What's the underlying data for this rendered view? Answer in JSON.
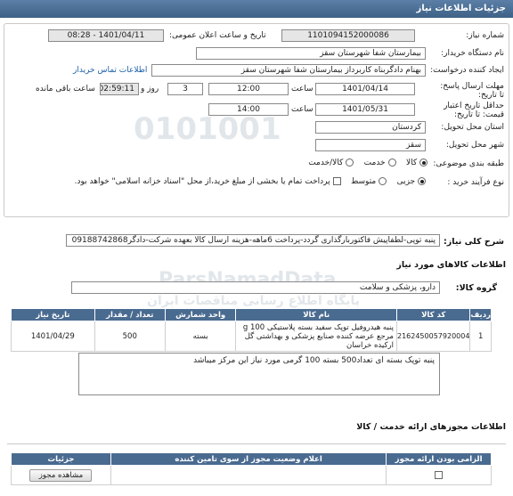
{
  "header": {
    "title": "جزئیات اطلاعات نیاز"
  },
  "fields": {
    "need_number_label": "شماره نیاز:",
    "need_number": "1101094152000086",
    "announce_label": "تاریخ و ساعت اعلان عمومی:",
    "announce_value": "1401/04/11 - 08:28",
    "buyer_label": "نام دستگاه خریدار:",
    "buyer": "بیمارستان شفا شهرستان سقز",
    "creator_label": "ایجاد کننده درخواست:",
    "creator": "بهنام دادگربناه کاربرداز بیمارستان شفا شهرستان سقز",
    "contact_link": "اطلاعات تماس خریدار",
    "deadline_label": "مهلت ارسال پاسخ: تا تاریخ:",
    "deadline_date": "1401/04/14",
    "time_label": "ساعت",
    "deadline_time": "12:00",
    "days": "3",
    "days_label": "روز و",
    "remaining": "02:59:11",
    "remaining_label": "ساعت باقی مانده",
    "validity_label": "حداقل تاریخ اعتبار قیمت: تا تاریخ:",
    "validity_date": "1401/05/31",
    "validity_time_label": "ساعت",
    "validity_time": "14:00",
    "province_label": "استان محل تحویل:",
    "province": "کردستان",
    "city_label": "شهر محل تحویل:",
    "city": "سقز",
    "category_label": "طبقه بندی موضوعی:",
    "cat_opt1": "کالا",
    "cat_opt2": "خدمت",
    "cat_opt3": "کالا/خدمت",
    "purchase_label": "نوع فرآیند خرید :",
    "purchase_opt1": "جزیی",
    "purchase_opt2": "متوسط",
    "purchase_note": "پرداخت تمام یا بخشی از مبلغ خرید،از محل \"اسناد خزانه اسلامی\" خواهد بود."
  },
  "summary": {
    "label": "شرح کلی نیاز:",
    "text": "پنبه توپی-لطفاپیش فاکتوربارگذاری گردد-پرداخت 6ماهه-هزینه ارسال کالا بعهده شرکت-دادگر09188742868"
  },
  "goods": {
    "title": "اطلاعات کالاهای مورد نیاز",
    "group_label": "گروه کالا:",
    "group_value": "دارو، پزشکی و سلامت",
    "columns": [
      "ردیف",
      "کد کالا",
      "نام کالا",
      "واحد شمارش",
      "تعداد / مقدار",
      "تاریخ نیاز"
    ],
    "rows": [
      {
        "row": "1",
        "code": "2162450057920004",
        "name": "پنبه هیدروفیل توپک سفید بسته پلاستیکی 100 g مرجع عرضه کننده صنایع پزشکی و بهداشتی گل ارکیده خراسان",
        "unit": "بسته",
        "qty": "500",
        "date": "1401/04/29"
      }
    ],
    "note": "پنبه توپک بسته ای تعداد500 بسته 100 گرمی مورد نیاز این مرکز میباشد"
  },
  "suppliers": {
    "title": "اطلاعات مجوزهای ارائه خدمت / کالا",
    "columns": [
      "الزامی بودن ارائه مجوز",
      "اعلام وضعیت مجوز از سوی تامین کننده",
      "جزئیات"
    ],
    "status": "",
    "view_button": "مشاهده مجوز"
  },
  "watermark": {
    "t1": "ParsNamadData",
    "t2": "پایگاه اطلاع رسانی مناقصات ایران"
  },
  "colors": {
    "header": "#4a6b90",
    "link": "#1b5fa6"
  }
}
